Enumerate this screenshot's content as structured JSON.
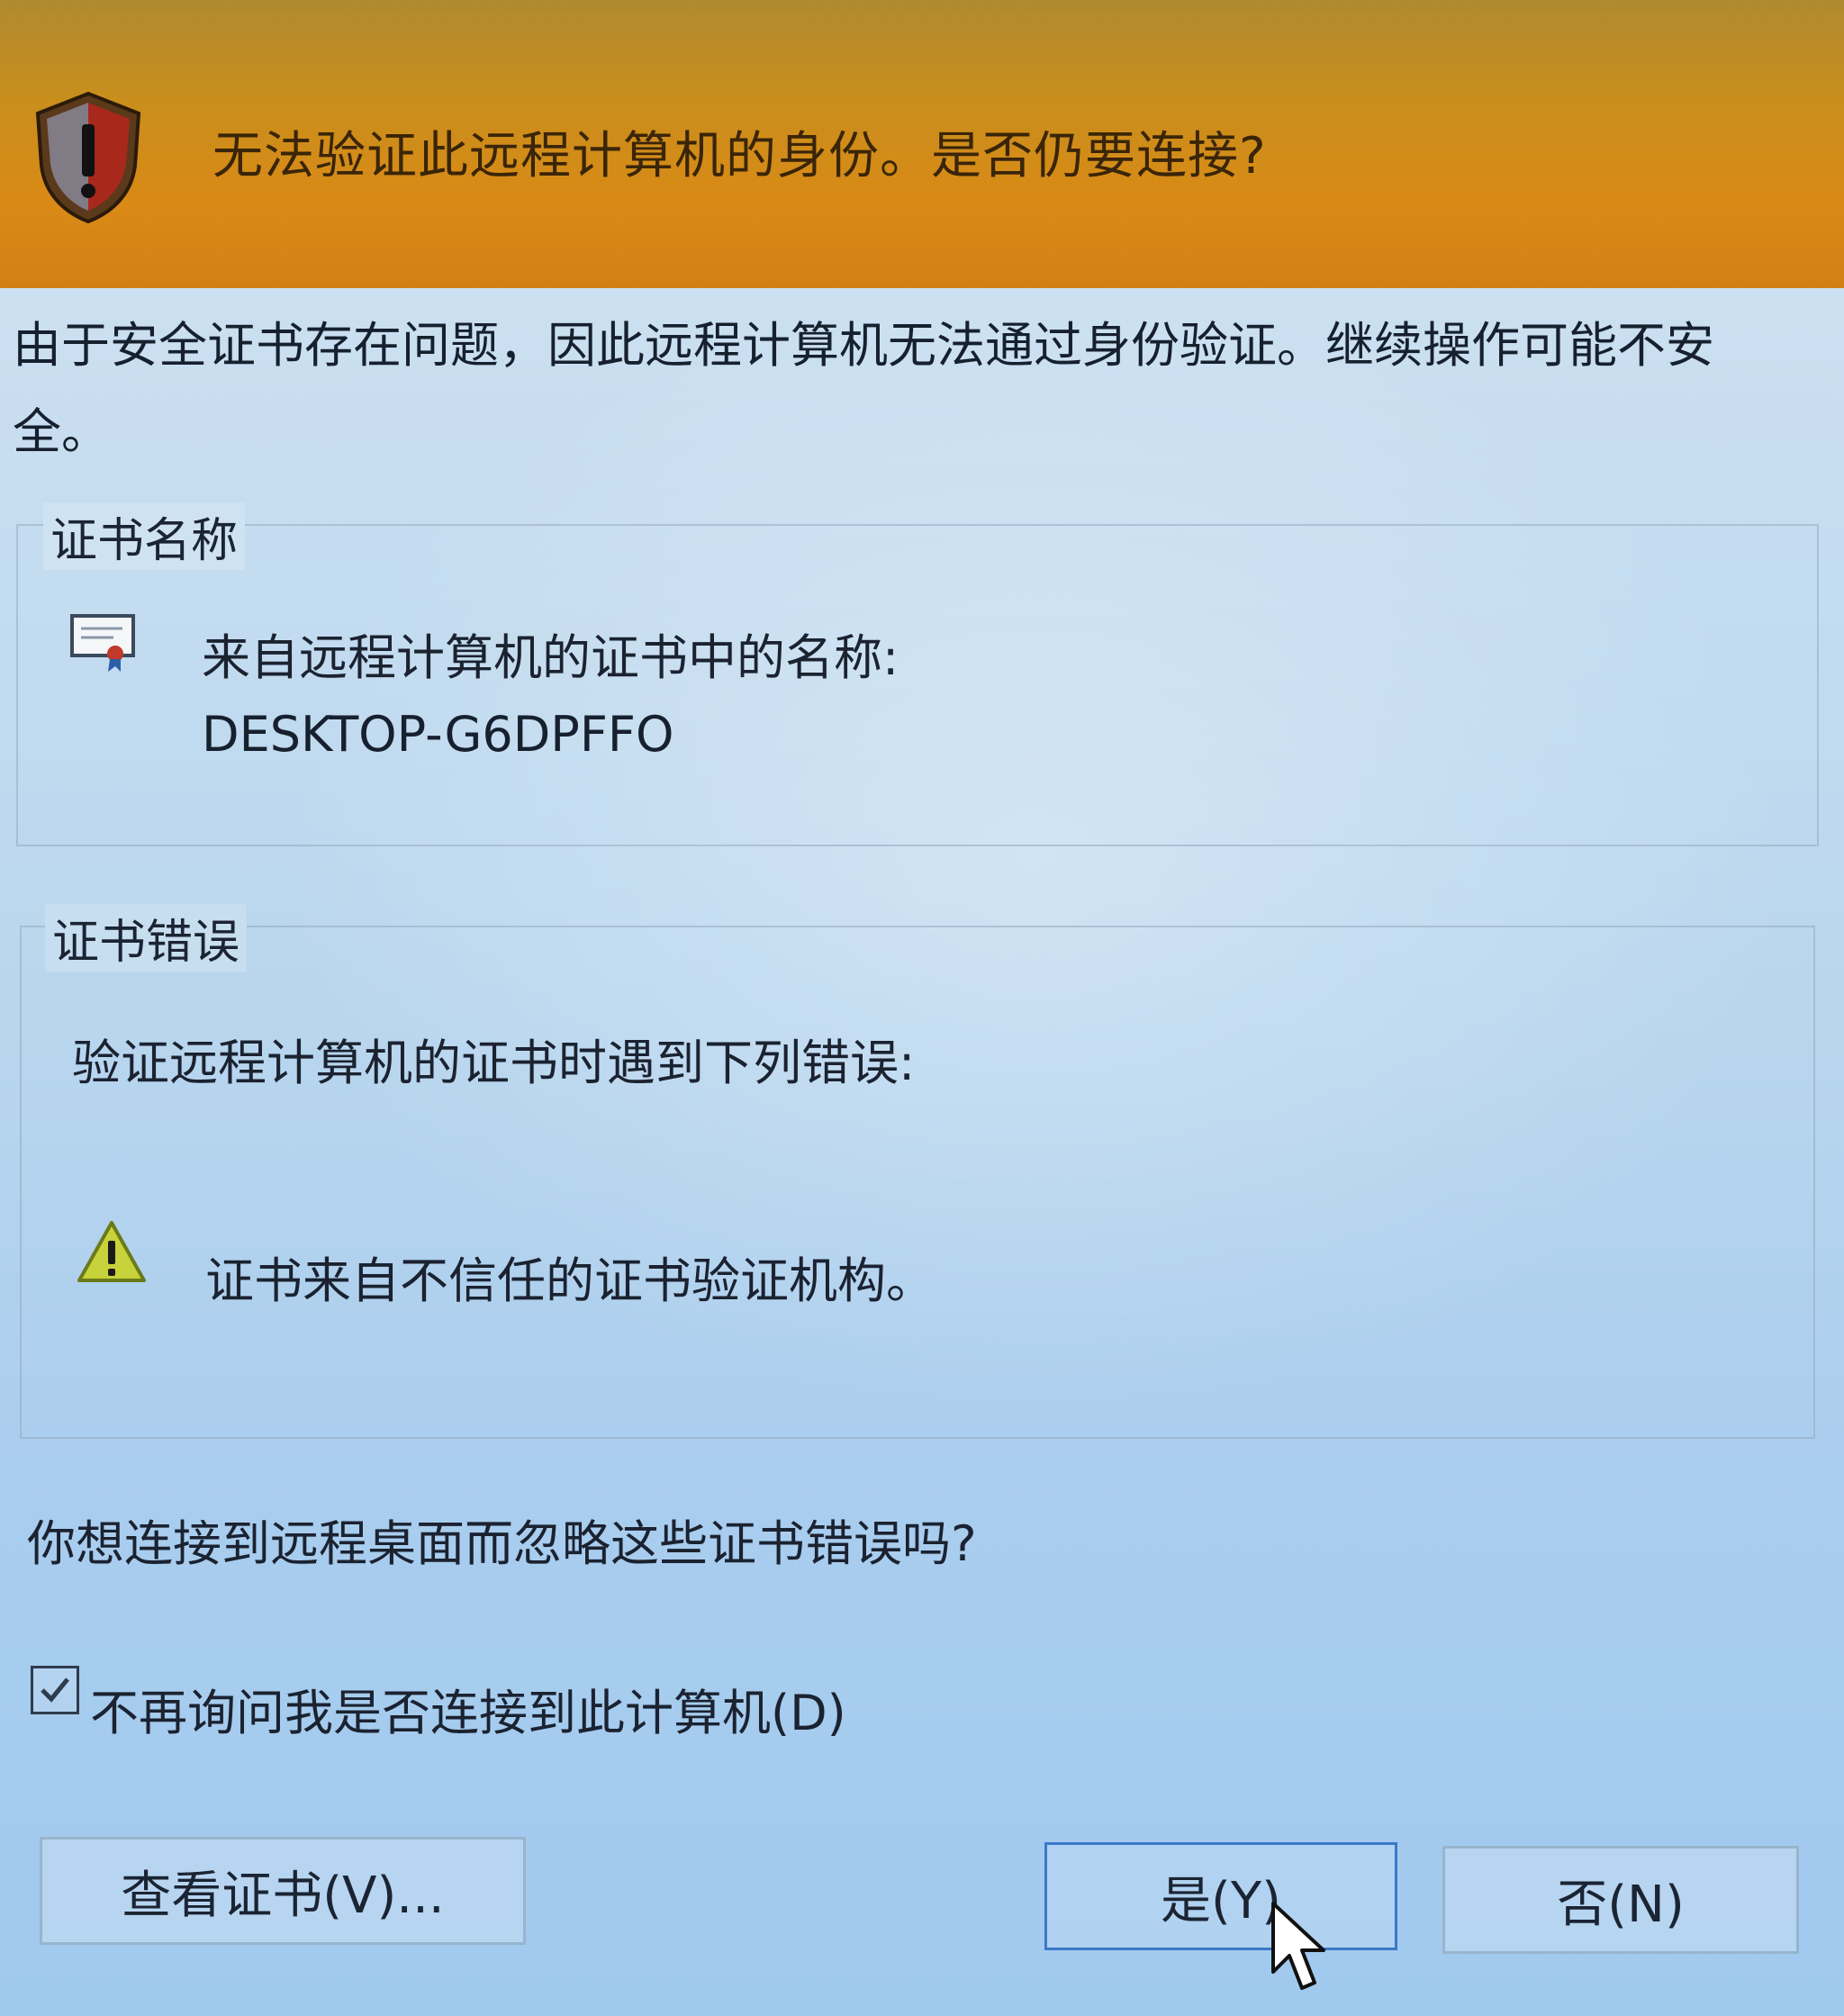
{
  "header": {
    "title": "无法验证此远程计算机的身份。是否仍要连接?",
    "icon": "shield-warning-icon"
  },
  "intro": "由于安全证书存在问题，因此远程计算机无法通过身份验证。继续操作可能不安全。",
  "certificate_name": {
    "group_title": "证书名称",
    "icon": "certificate-icon",
    "label": "来自远程计算机的证书中的名称:",
    "value": "DESKTOP-G6DPFFO"
  },
  "certificate_errors": {
    "group_title": "证书错误",
    "intro": "验证远程计算机的证书时遇到下列错误:",
    "items": [
      {
        "icon": "warning-icon",
        "text": "证书来自不信任的证书验证机构。"
      }
    ]
  },
  "question": "你想连接到远程桌面而忽略这些证书错误吗?",
  "checkbox": {
    "label": "不再询问我是否连接到此计算机(D)",
    "checked": true
  },
  "buttons": {
    "view_cert": "查看证书(V)...",
    "yes": "是(Y)",
    "no": "否(N)"
  },
  "colors": {
    "header_band": "#d2891a",
    "dialog_bg": "#c3dbef",
    "focus_border": "#3b78c8"
  }
}
